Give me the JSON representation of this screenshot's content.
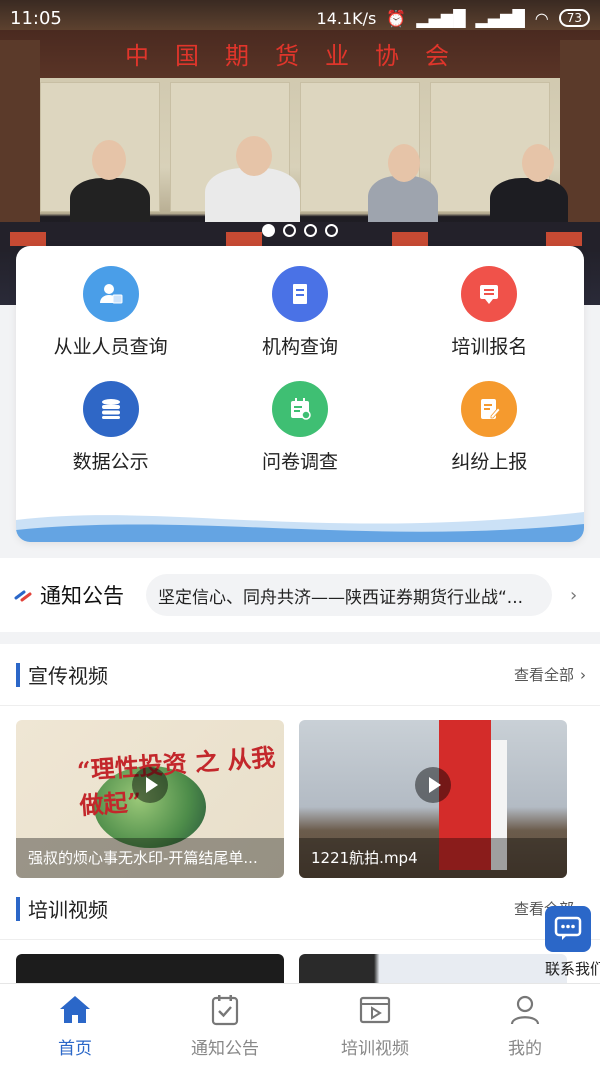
{
  "status_bar": {
    "time": "11:05",
    "speed": "14.1K/s",
    "battery": "73"
  },
  "banner": {
    "text": "中国期货业协会",
    "slide_count": 4,
    "active_slide": 0
  },
  "quick_actions": [
    {
      "label": "从业人员查询",
      "icon": "person-card-icon",
      "color": "#4a9ee8"
    },
    {
      "label": "机构查询",
      "icon": "building-icon",
      "color": "#4a72e6"
    },
    {
      "label": "培训报名",
      "icon": "register-icon",
      "color": "#f0524a"
    },
    {
      "label": "数据公示",
      "icon": "database-icon",
      "color": "#2f67c6"
    },
    {
      "label": "问卷调查",
      "icon": "survey-icon",
      "color": "#3fbf73"
    },
    {
      "label": "纠纷上报",
      "icon": "report-icon",
      "color": "#f59a2e"
    }
  ],
  "notice": {
    "title": "通知公告",
    "text": "坚定信心、同舟共济——陕西证券期货行业战“..."
  },
  "promo_videos": {
    "title": "宣传视频",
    "more": "查看全部",
    "items": [
      {
        "caption": "强叔的烦心事无水印-开篇结尾单...",
        "slogan": "“理性投资 之 从我做起”"
      },
      {
        "caption": "1221航拍.mp4"
      }
    ]
  },
  "training_videos": {
    "title": "培训视频",
    "more": "查看全部"
  },
  "contact": {
    "label": "联系我们"
  },
  "tabbar": [
    {
      "label": "首页",
      "active": true
    },
    {
      "label": "通知公告",
      "active": false
    },
    {
      "label": "培训视频",
      "active": false
    },
    {
      "label": "我的",
      "active": false
    }
  ]
}
